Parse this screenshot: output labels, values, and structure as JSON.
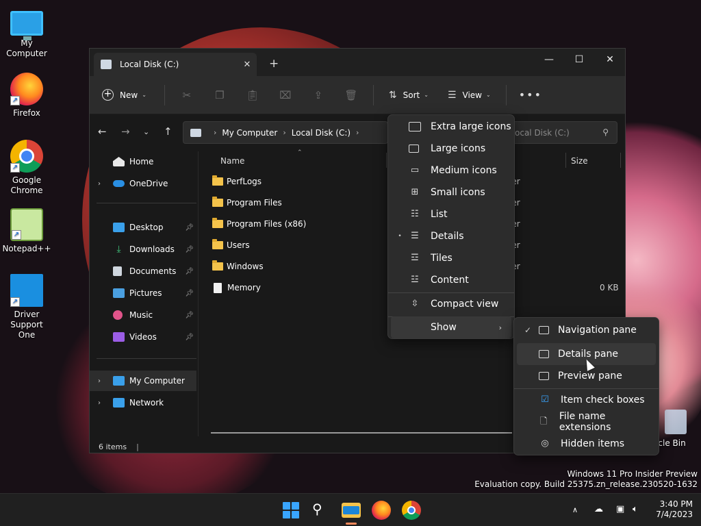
{
  "desktop": {
    "icons": [
      {
        "label": "My Computer",
        "icon": "monitor-icon"
      },
      {
        "label": "Firefox",
        "icon": "firefox-icon"
      },
      {
        "label": "Google Chrome",
        "icon": "chrome-icon"
      },
      {
        "label": "Notepad++",
        "icon": "notepad-plus-plus-icon"
      },
      {
        "label": "Driver Support One",
        "icon": "driver-support-icon"
      }
    ],
    "recycle_bin_label": "ycle Bin",
    "watermark": {
      "line1": "Windows 11 Pro Insider Preview",
      "line2": "Evaluation copy. Build 25375.zn_release.230520-1632"
    }
  },
  "window": {
    "tab_title": "Local Disk (C:)",
    "tab_close": "✕",
    "new_tab": "+",
    "controls": {
      "minimize": "—",
      "maximize": "☐",
      "close": "✕"
    },
    "toolbar": {
      "new_label": "New",
      "sort_label": "Sort",
      "view_label": "View",
      "more_label": "•••",
      "icons": [
        "cut-icon",
        "copy-icon",
        "paste-icon",
        "rename-icon",
        "share-icon",
        "delete-icon"
      ]
    },
    "breadcrumb": [
      "My Computer",
      "Local Disk (C:)"
    ],
    "search_placeholder": "ocal Disk (C:)",
    "nav_pane": {
      "items": [
        {
          "label": "Home",
          "icon": "home-icon",
          "expandable": false,
          "pinned": false
        },
        {
          "label": "OneDrive",
          "icon": "cloud-icon",
          "expandable": true,
          "pinned": false
        },
        {
          "label": "Desktop",
          "icon": "desktop-folder-icon",
          "expandable": false,
          "pinned": true
        },
        {
          "label": "Downloads",
          "icon": "downloads-icon",
          "expandable": false,
          "pinned": true
        },
        {
          "label": "Documents",
          "icon": "documents-icon",
          "expandable": false,
          "pinned": true
        },
        {
          "label": "Pictures",
          "icon": "pictures-icon",
          "expandable": false,
          "pinned": true
        },
        {
          "label": "Music",
          "icon": "music-icon",
          "expandable": false,
          "pinned": true
        },
        {
          "label": "Videos",
          "icon": "videos-icon",
          "expandable": false,
          "pinned": true
        },
        {
          "label": "My Computer",
          "icon": "computer-icon",
          "expandable": true,
          "pinned": false,
          "selected": true
        },
        {
          "label": "Network",
          "icon": "network-icon",
          "expandable": true,
          "pinned": false
        }
      ]
    },
    "columns": {
      "name": "Name",
      "size": "Size"
    },
    "files": [
      {
        "name": "PerfLogs",
        "kind": "folder",
        "type": "ler",
        "size": ""
      },
      {
        "name": "Program Files",
        "kind": "folder",
        "type": "ler",
        "size": ""
      },
      {
        "name": "Program Files (x86)",
        "kind": "folder",
        "type": "ler",
        "size": ""
      },
      {
        "name": "Users",
        "kind": "folder",
        "type": "ler",
        "size": ""
      },
      {
        "name": "Windows",
        "kind": "folder",
        "type": "ler",
        "size": ""
      },
      {
        "name": "Memory",
        "kind": "file",
        "type": "",
        "size": "0 KB"
      }
    ],
    "status": {
      "count": "6 items",
      "separator": "|"
    }
  },
  "view_menu": {
    "items": [
      {
        "label": "Extra large icons",
        "icon": "square-icon"
      },
      {
        "label": "Large icons",
        "icon": "square-icon"
      },
      {
        "label": "Medium icons",
        "icon": "monitor-small-icon"
      },
      {
        "label": "Small icons",
        "icon": "grid-icon"
      },
      {
        "label": "List",
        "icon": "list-icon"
      },
      {
        "label": "Details",
        "icon": "details-icon",
        "selected": true
      },
      {
        "label": "Tiles",
        "icon": "tiles-icon"
      },
      {
        "label": "Content",
        "icon": "content-icon"
      },
      {
        "label": "Compact view",
        "icon": "compact-icon"
      },
      {
        "label": "Show",
        "icon": "",
        "submenu": true
      }
    ],
    "selected_mark": "•",
    "submenu_arrow": "›"
  },
  "show_menu": {
    "items": [
      {
        "label": "Navigation pane",
        "icon": "navigation-pane-icon",
        "checked": true
      },
      {
        "label": "Details pane",
        "icon": "details-pane-icon",
        "checked": false
      },
      {
        "label": "Preview pane",
        "icon": "preview-pane-icon",
        "checked": false
      },
      {
        "label": "Item check boxes",
        "icon": "checkbox-icon",
        "checked": false
      },
      {
        "label": "File name extensions",
        "icon": "file-icon",
        "checked": false
      },
      {
        "label": "Hidden items",
        "icon": "eye-icon",
        "checked": false
      }
    ],
    "check_mark": "✓"
  },
  "taskbar": {
    "apps": [
      "start-icon",
      "search-icon",
      "file-explorer-icon",
      "firefox-icon",
      "chrome-icon"
    ],
    "tray": {
      "chevron": "∧"
    },
    "clock": {
      "time": "3:40 PM",
      "date": "7/4/2023"
    }
  },
  "colors": {
    "accent": "#39a5ff",
    "folder": "#f4c34b",
    "window_bg": "#191919",
    "menu_bg": "#2c2c2c"
  }
}
